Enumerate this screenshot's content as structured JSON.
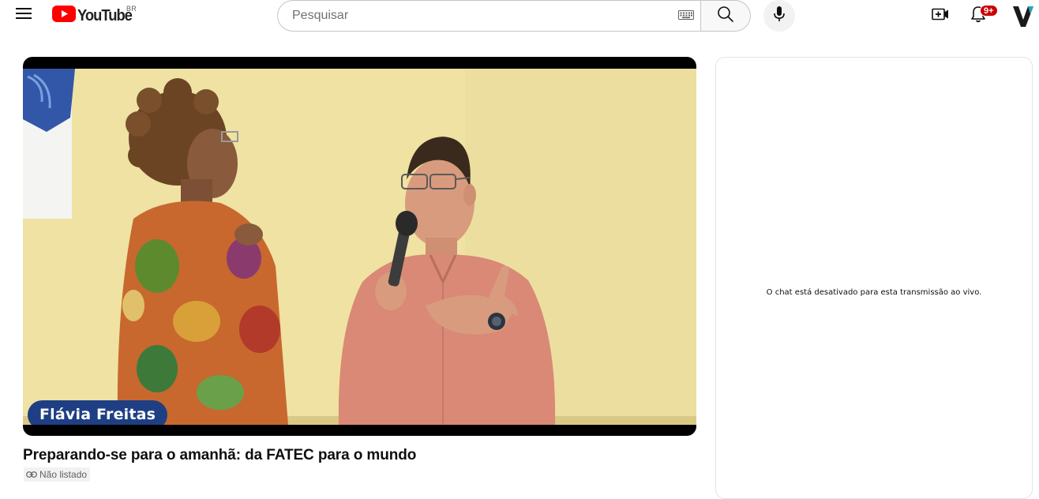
{
  "header": {
    "logo_text": "YouTube",
    "country_code": "BR",
    "search": {
      "placeholder": "Pesquisar",
      "value": ""
    },
    "notifications": {
      "badge": "9+"
    },
    "avatar_letter": "V",
    "icons": {
      "menu": "menu-icon",
      "keyboard": "keyboard-icon",
      "search": "search-icon",
      "mic": "mic-icon",
      "create": "create-video-icon",
      "notifications": "bell-icon"
    }
  },
  "player": {
    "lower_third_name": "Flávia Freitas"
  },
  "video": {
    "title": "Preparando-se para o amanhã: da FATEC para o mundo",
    "privacy": "Não listado"
  },
  "chat": {
    "disabled_message": "O chat está desativado para esta transmissão ao vivo."
  },
  "colors": {
    "brand_red": "#ff0000",
    "badge_red": "#cc0000",
    "name_tag_blue": "#1f3f84",
    "avatar_teal": "#2aa4b8"
  }
}
